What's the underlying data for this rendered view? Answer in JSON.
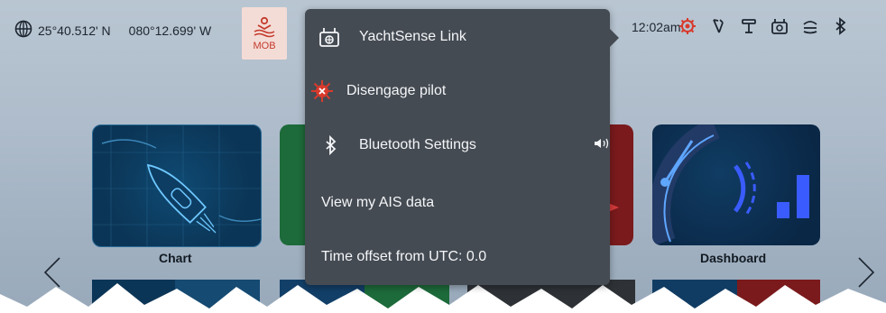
{
  "status": {
    "latitude": "25°40.512' N",
    "longitude": "080°12.699' W",
    "mob_label": "MOB",
    "time": "12:02am"
  },
  "menu": {
    "items": [
      {
        "label": "YachtSense Link",
        "icon": "yachtsense-icon"
      },
      {
        "label": "Disengage pilot",
        "icon": "pilot-icon"
      },
      {
        "label": "Bluetooth Settings",
        "icon": "bluetooth-icon"
      },
      {
        "label": "View my AIS data",
        "icon": ""
      },
      {
        "label": "Time offset from UTC: 0.0",
        "icon": ""
      }
    ]
  },
  "tiles": {
    "chart_label": "Chart",
    "dashboard_label": "Dashboard"
  },
  "colors": {
    "menu_bg": "#454b53",
    "alert_red": "#d83a2c",
    "chart_tile": "#0b3556",
    "dash_accent": "#3a5cff"
  }
}
